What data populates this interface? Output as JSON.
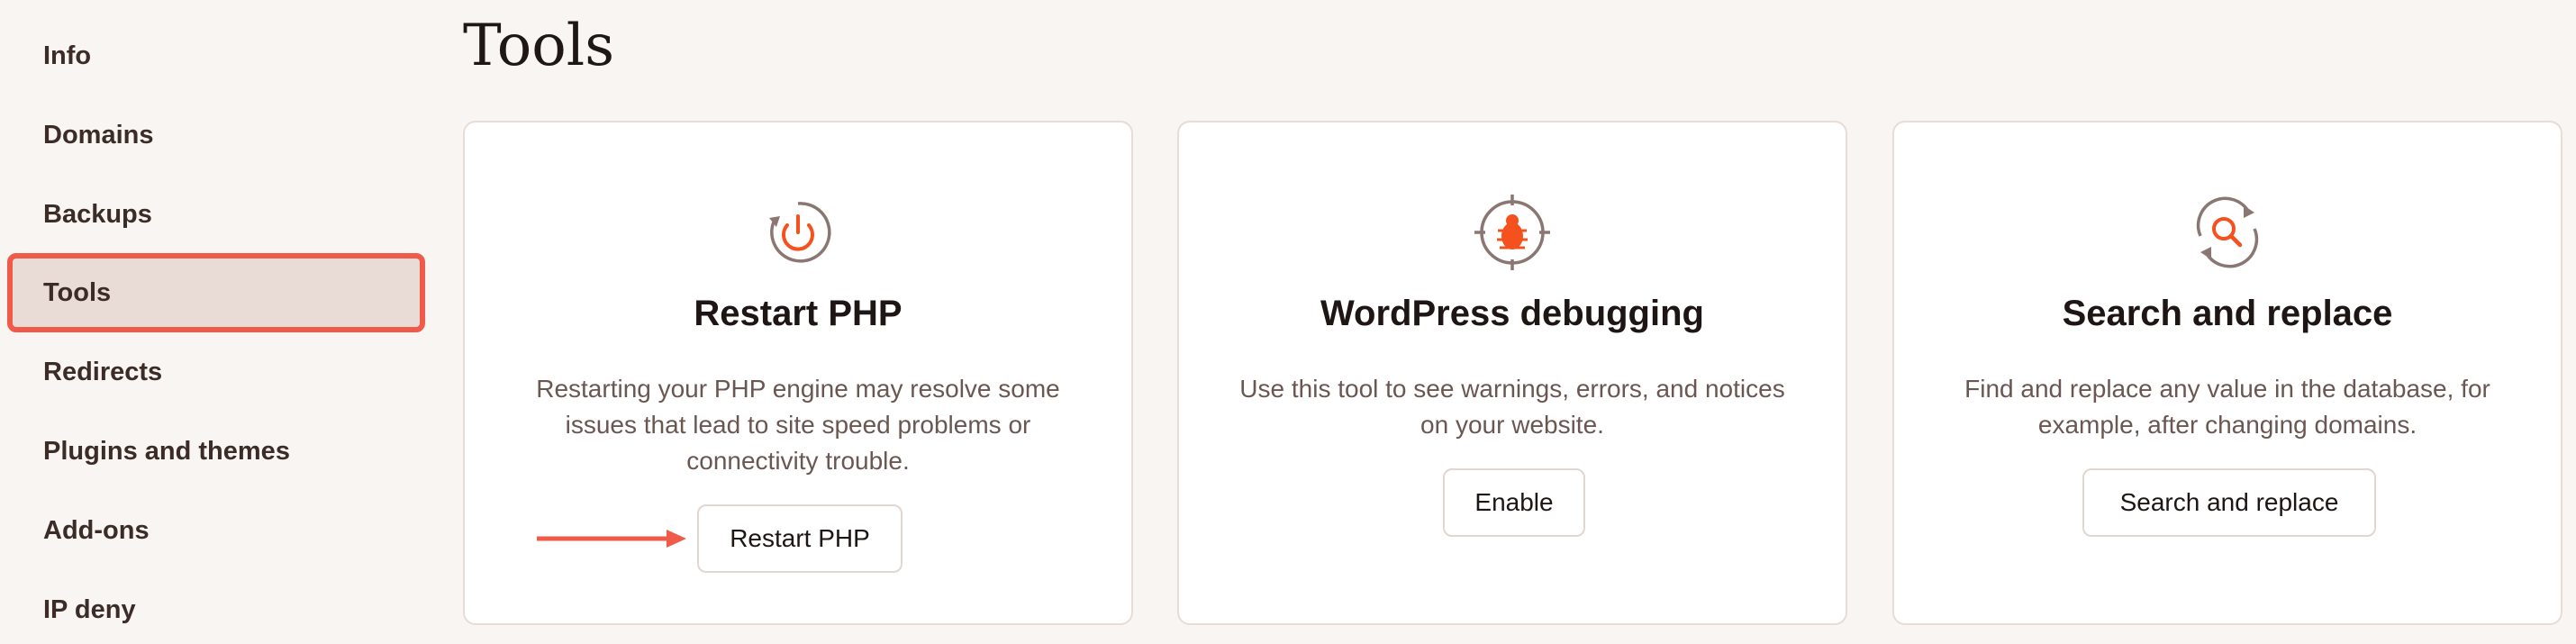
{
  "sidebar": {
    "items": [
      {
        "label": "Info"
      },
      {
        "label": "Domains"
      },
      {
        "label": "Backups"
      },
      {
        "label": "Tools",
        "active": true
      },
      {
        "label": "Redirects"
      },
      {
        "label": "Plugins and themes"
      },
      {
        "label": "Add-ons"
      },
      {
        "label": "IP deny"
      }
    ]
  },
  "page": {
    "title": "Tools"
  },
  "cards": [
    {
      "icon": "restart-power-icon",
      "title": "Restart PHP",
      "description": "Restarting your PHP engine may resolve some issues that lead to site speed problems or connectivity trouble.",
      "button": "Restart PHP"
    },
    {
      "icon": "bug-target-icon",
      "title": "WordPress debugging",
      "description": "Use this tool to see warnings, errors, and notices on your website.",
      "button": "Enable"
    },
    {
      "icon": "search-replace-icon",
      "title": "Search and replace",
      "description": "Find and replace any value in the database, for example, after changing domains.",
      "button": "Search and replace"
    }
  ],
  "colors": {
    "accent": "#f05a48",
    "icon_orange": "#f4511e",
    "icon_gray": "#8a7672",
    "active_bg": "#e9dcd6"
  }
}
